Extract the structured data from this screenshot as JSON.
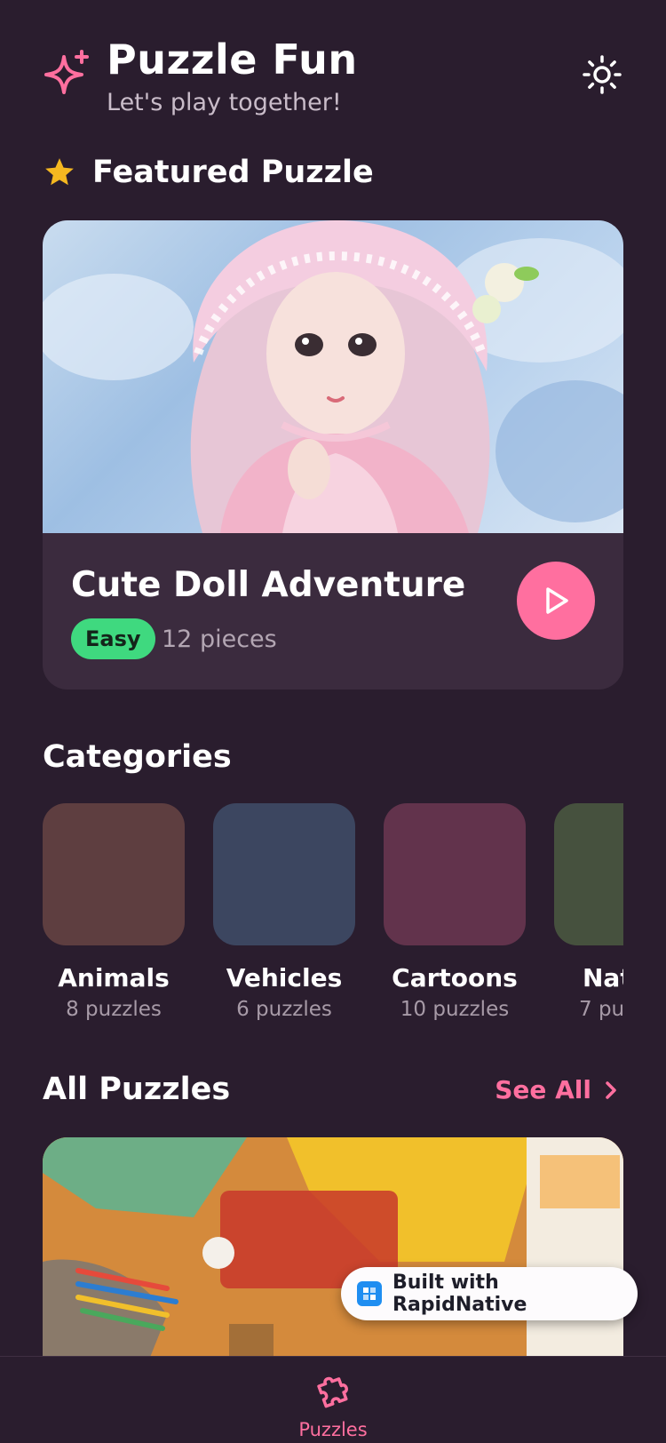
{
  "header": {
    "title": "Puzzle Fun",
    "subtitle": "Let's play together!",
    "logo_icon": "sparkle-icon",
    "theme_icon": "sun-icon"
  },
  "featured": {
    "section_title": "Featured Puzzle",
    "section_icon": "star-icon",
    "name": "Cute Doll Adventure",
    "difficulty": "Easy",
    "pieces": "12 pieces",
    "play_icon": "play-icon"
  },
  "categories": {
    "section_title": "Categories",
    "items": [
      {
        "name": "Animals",
        "count": "8 puzzles",
        "color": "#5e3e40"
      },
      {
        "name": "Vehicles",
        "count": "6 puzzles",
        "color": "#3c4660"
      },
      {
        "name": "Cartoons",
        "count": "10 puzzles",
        "color": "#62334c"
      },
      {
        "name": "Nat",
        "count": "7 pu",
        "color": "#46513e"
      }
    ]
  },
  "all_puzzles": {
    "section_title": "All Puzzles",
    "see_all_label": "See All"
  },
  "rapidnative_badge": {
    "label": "Built with RapidNative"
  },
  "tabbar": {
    "puzzles_label": "Puzzles",
    "puzzles_icon": "puzzle-piece-icon"
  },
  "colors": {
    "background": "#2a1d2e",
    "accent": "#ff6f9f",
    "card": "#3b2b3e",
    "easy_badge": "#3fd97f",
    "star": "#f5b820"
  }
}
